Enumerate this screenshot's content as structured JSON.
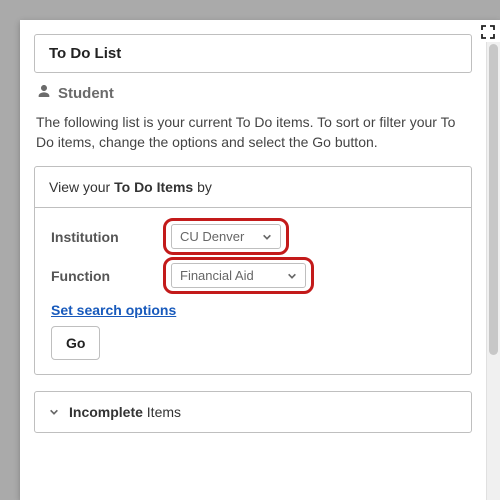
{
  "header": {
    "title": "To Do List"
  },
  "role": {
    "label": "Student"
  },
  "description": "The following list is your current To Do items. To sort or filter your To Do items, change the options and select the Go button.",
  "filter": {
    "heading_prefix": "View your ",
    "heading_strong": "To Do Items",
    "heading_suffix": " by",
    "institution_label": "Institution",
    "institution_value": "CU Denver",
    "function_label": "Function",
    "function_value": "Financial Aid",
    "search_options_link": "Set search options",
    "go_label": "Go"
  },
  "sections": {
    "incomplete_strong": "Incomplete",
    "incomplete_rest": " Items"
  },
  "icons": {
    "user": "user-icon",
    "chevron_down": "chevron-down-icon",
    "expand": "expand-icon"
  },
  "colors": {
    "highlight": "#c31a1a",
    "link": "#185abc"
  }
}
